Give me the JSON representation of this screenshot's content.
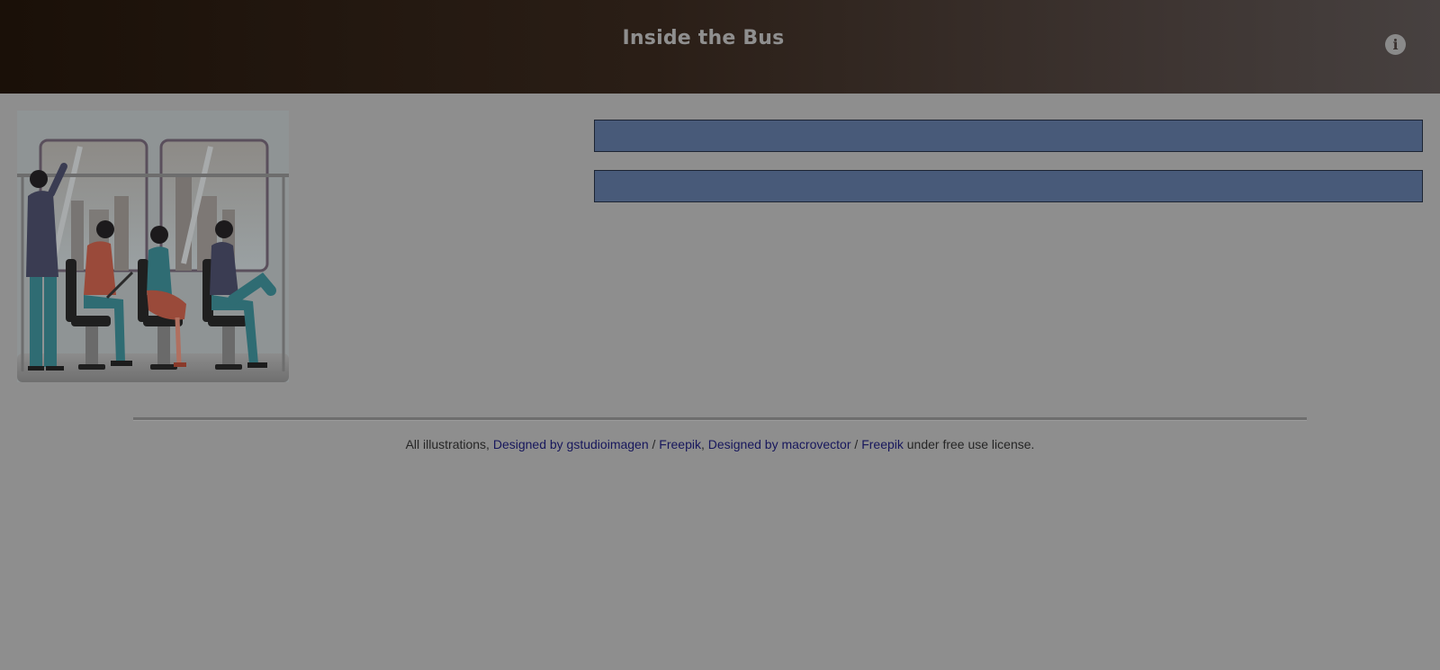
{
  "header": {
    "title": "Inside the Bus",
    "info_icon": "info-circle-icon"
  },
  "illustration": {
    "icon": "bus-passengers-illustration",
    "colors": {
      "window_frame": "#5a4f5c",
      "seat": "#1f1f1f",
      "teal_pants": "#2f6c73",
      "red_shirt": "#9a4a3a",
      "dark_jacket": "#3a3c52"
    }
  },
  "options": [
    {
      "label": ""
    },
    {
      "label": ""
    }
  ],
  "footer": {
    "prefix": "All illustrations, ",
    "link1": "Designed by gstudioimagen",
    "sep1": " / ",
    "link2": "Freepik",
    "sep2": ", ",
    "link3": "Designed by macrovector",
    "sep3": " / ",
    "link4": "Freepik",
    "suffix": " under free use license."
  },
  "colors": {
    "overlay_bg": "#8e8e8e",
    "bar": "#485a79",
    "link": "#17175c"
  }
}
